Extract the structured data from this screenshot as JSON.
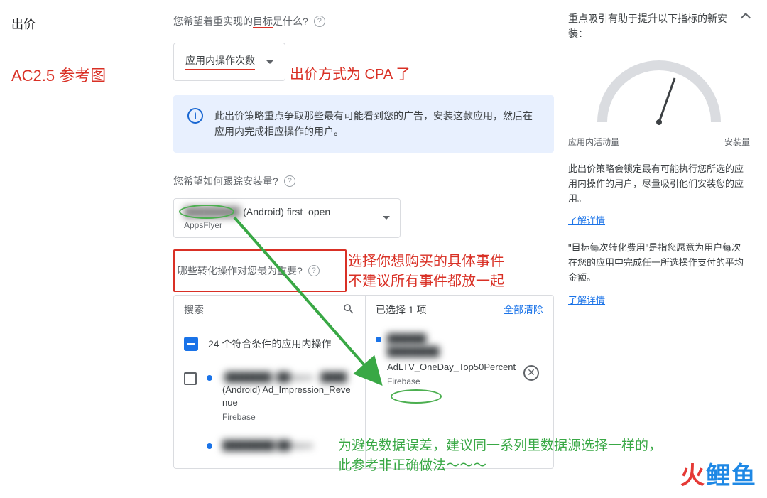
{
  "left": {
    "title": "出价",
    "ref": "AC2.5 参考图"
  },
  "main": {
    "q1_pre": "您希望着重实现的",
    "q1_underlined": "目标",
    "q1_post": "是什么?",
    "goal_dropdown": "应用内操作次数",
    "cpa_note": "出价方式为 CPA 了",
    "info": "此出价策略重点争取那些最有可能看到您的广告，安装这款应用，然后在应用内完成相应操作的用户。",
    "q2": "您希望如何跟踪安装量?",
    "install_main_blur": "████████",
    "install_main_rest": " (Android) first_open",
    "install_sub": "AppsFlyer",
    "q3": "哪些转化操作对您最为重要?",
    "event_note_l1": "选择你想购买的具体事件",
    "event_note_l2": "不建议所有事件都放一起",
    "green_note_l1": "为避免数据误差，建议同一系列里数据源选择一样的，",
    "green_note_l2": "此参考非正确做法～～～"
  },
  "picker": {
    "search_label": "搜索",
    "selected_count": "已选择 1 项",
    "clear_all": "全部清除",
    "count_row": "24 个符合条件的应用内操作",
    "item1_blur": "(███████) ██topus - ████",
    "item1_text": "(Android) Ad_Impression_Revenue",
    "item1_sub": "Firebase",
    "item2_blur": "████████ ██topus",
    "selected_blur1": "██████",
    "selected_blur2": "████████",
    "selected_text": "AdLTV_OneDay_Top50Percent",
    "selected_sub": "Firebase"
  },
  "side": {
    "title": "重点吸引有助于提升以下指标的新安装：",
    "gauge_left": "应用内活动量",
    "gauge_right": "安装量",
    "p1": "此出价策略会锁定最有可能执行您所选的应用内操作的用户，尽量吸引他们安装您的应用。",
    "link": "了解详情",
    "p2": "\"目标每次转化费用\"是指您愿意为用户每次在您的应用中完成任一所选操作支付的平均金额。"
  },
  "watermark": {
    "c1": "火",
    "c2": "鲤",
    "c3": "鱼"
  }
}
